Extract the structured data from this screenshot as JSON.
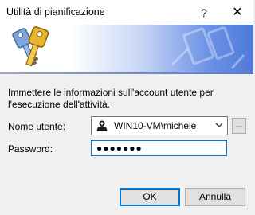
{
  "window": {
    "title": "Utilità di pianificazione",
    "help_glyph": "?",
    "close_glyph": "✕"
  },
  "banner": {
    "icon": "keys-icon",
    "gradient_start": "#ffffff",
    "gradient_end": "#4f7ad9"
  },
  "form": {
    "instructions": "Immettere le informazioni sull'account utente per l'esecuzione dell'attività.",
    "username_label": "Nome utente:",
    "username_value": "WIN10-VM\\michele",
    "browse_label": "...",
    "password_label": "Password:",
    "password_value": "●●●●●●●"
  },
  "buttons": {
    "ok_label": "OK",
    "cancel_label": "Annulla"
  },
  "colors": {
    "focus_border": "#0078d7",
    "dialog_bg": "#f0f0f0"
  }
}
